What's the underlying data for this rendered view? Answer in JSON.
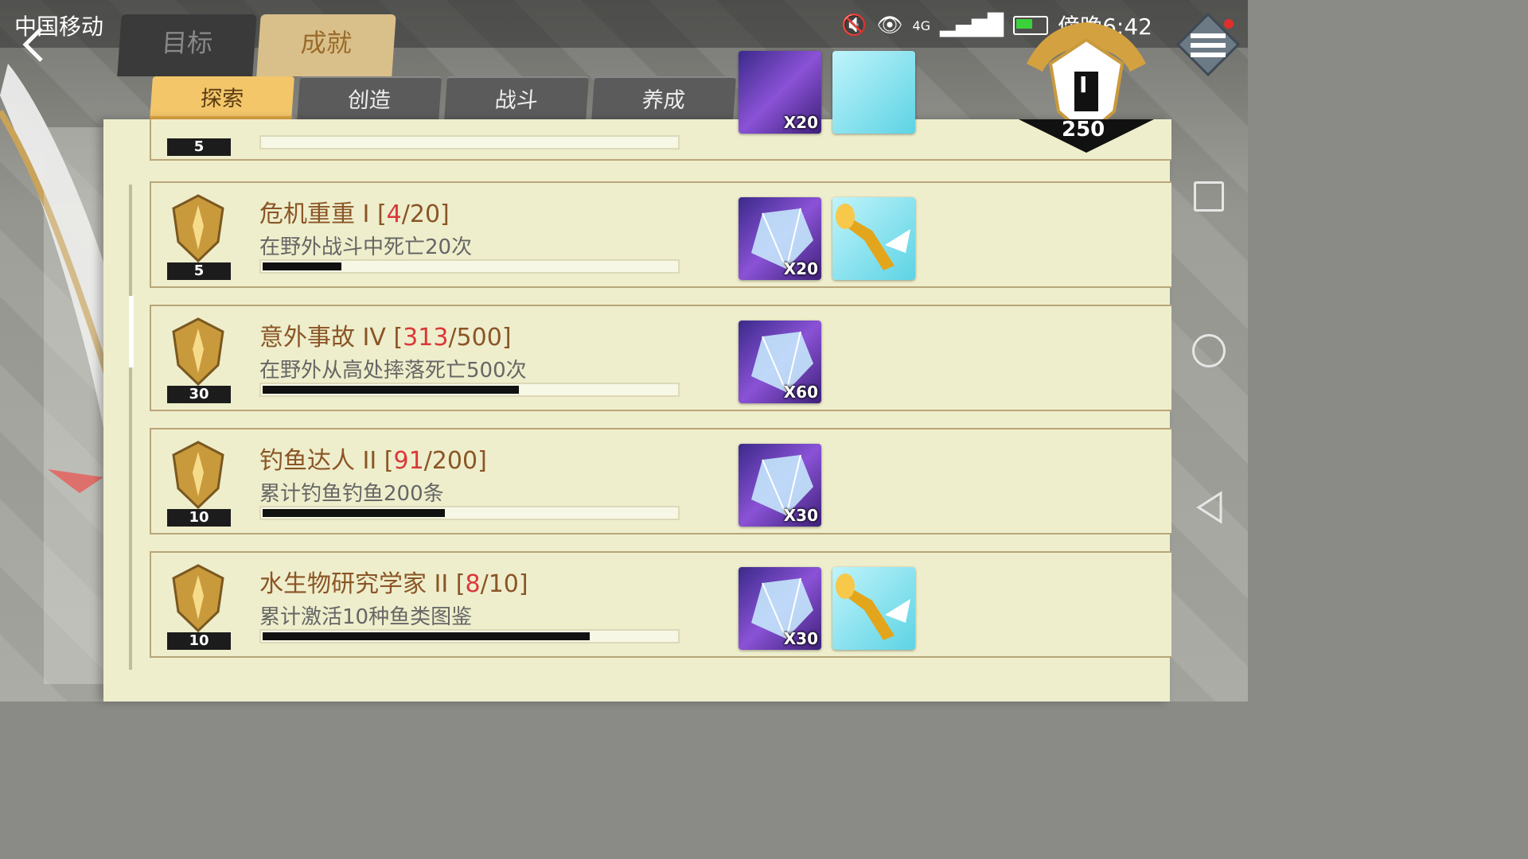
{
  "status_bar": {
    "carrier": "中国移动",
    "network": "4G",
    "time": "傍晚6:42"
  },
  "tabs": {
    "main": [
      {
        "label": "目标",
        "active": false
      },
      {
        "label": "成就",
        "active": true
      }
    ],
    "sub": [
      {
        "label": "探索",
        "active": true
      },
      {
        "label": "创造",
        "active": false
      },
      {
        "label": "战斗",
        "active": false
      },
      {
        "label": "养成",
        "active": false
      }
    ]
  },
  "rank_badge": {
    "tier": "I",
    "points": "250"
  },
  "achievements": [
    {
      "level": "5",
      "title": "",
      "current": "",
      "total": "",
      "description": "",
      "progress": 0,
      "rewards": [
        {
          "type": "crystal-icon",
          "qty": "X20"
        },
        {
          "type": "horn-icon",
          "qty": ""
        }
      ]
    },
    {
      "level": "5",
      "name": "危机重重 I",
      "current": "4",
      "total": "20",
      "description": "在野外战斗中死亡20次",
      "progress": 0.19,
      "rewards": [
        {
          "type": "crystal-icon",
          "qty": "X20"
        },
        {
          "type": "horn-icon",
          "qty": ""
        }
      ]
    },
    {
      "level": "30",
      "name": "意外事故 IV",
      "current": "313",
      "total": "500",
      "description": "在野外从高处摔落死亡500次",
      "progress": 0.62,
      "rewards": [
        {
          "type": "crystal-icon",
          "qty": "X60"
        }
      ]
    },
    {
      "level": "10",
      "name": "钓鱼达人 II",
      "current": "91",
      "total": "200",
      "description": "累计钓鱼钓鱼200条",
      "progress": 0.44,
      "rewards": [
        {
          "type": "crystal-icon",
          "qty": "X30"
        }
      ]
    },
    {
      "level": "10",
      "name": "水生物研究学家 II",
      "current": "8",
      "total": "10",
      "description": "累计激活10种鱼类图鉴",
      "progress": 0.79,
      "rewards": [
        {
          "type": "crystal-icon",
          "qty": "X30"
        },
        {
          "type": "horn-icon",
          "qty": ""
        }
      ]
    }
  ],
  "colors": {
    "title": "#8b5526",
    "current": "#d9393a",
    "active_tab": "#f3c66a",
    "page": "#eeeecc"
  }
}
